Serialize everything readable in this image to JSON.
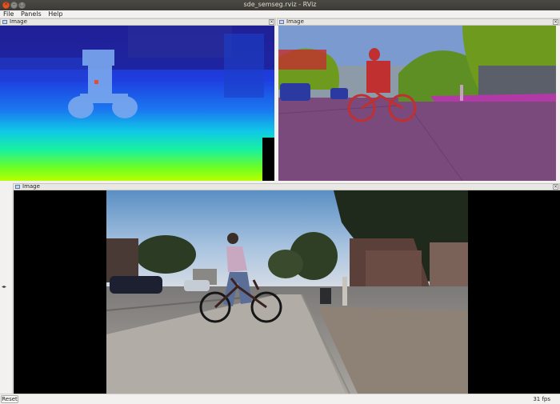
{
  "window": {
    "title": "sde_semseg.rviz - RViz",
    "close_glyph": "×",
    "min_glyph": "–",
    "max_glyph": "□"
  },
  "menu": {
    "items": [
      "File",
      "Panels",
      "Help"
    ]
  },
  "panels": {
    "depth": {
      "label": "Image",
      "close": "×"
    },
    "semseg": {
      "label": "Image",
      "close": "×"
    },
    "camera": {
      "label": "Image",
      "close": "×"
    }
  },
  "sidebar": {
    "toggle_glyph": "◂▸"
  },
  "status": {
    "reset_label": "Reset",
    "fps": "31 fps"
  },
  "colors": {
    "accent_close": "#e9541f",
    "titlebar": "#3c3b37",
    "depth_near": "#22ff00",
    "depth_far": "#1f2ab8",
    "seg_person": "#c03030",
    "seg_road": "#7a4a7c",
    "seg_vegetation": "#6e9a1e",
    "seg_sky": "#7a9ad0"
  },
  "icons": [
    "image-panel-icon",
    "close-icon",
    "sidebar-toggle-icon"
  ]
}
